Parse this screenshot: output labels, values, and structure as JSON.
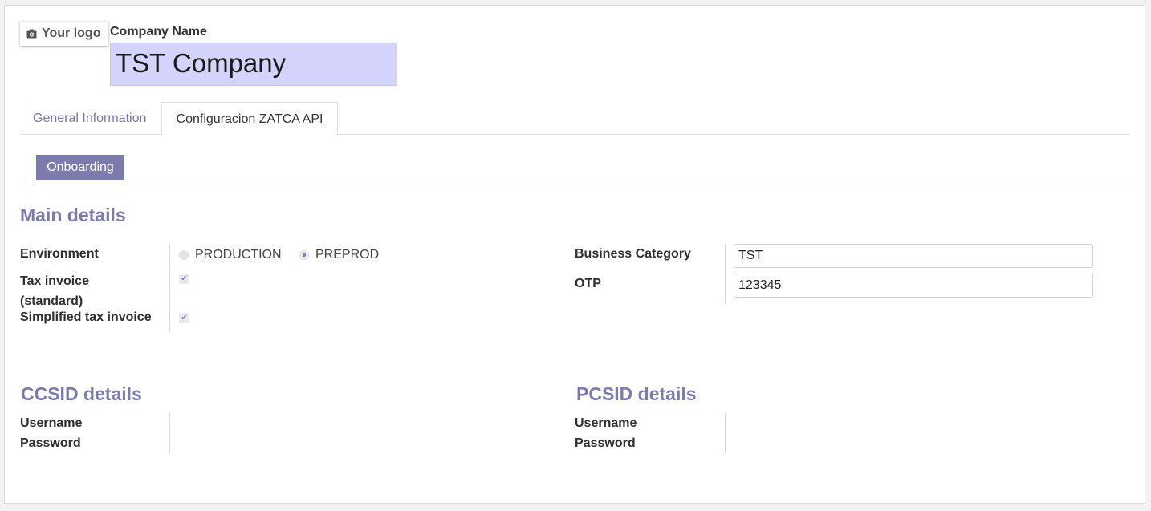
{
  "header": {
    "logo_label": "Your logo",
    "company_name_label": "Company Name",
    "company_name_value": "TST Company"
  },
  "tabs": [
    {
      "label": "General Information",
      "active": false
    },
    {
      "label": "Configuracion ZATCA API",
      "active": true
    }
  ],
  "buttons": {
    "onboarding": "Onboarding"
  },
  "main_details": {
    "title": "Main details",
    "environment_label": "Environment",
    "environment_options": [
      "PRODUCTION",
      "PREPROD"
    ],
    "environment_selected": "PREPROD",
    "tax_invoice_label_line1": "Tax invoice",
    "tax_invoice_label_line2": "(standard)",
    "tax_invoice_checked": true,
    "simplified_label": "Simplified tax invoice",
    "simplified_checked": true,
    "business_category_label": "Business Category",
    "business_category_value": "TST",
    "otp_label": "OTP",
    "otp_value": "123345"
  },
  "ccsid": {
    "title": "CCSID details",
    "username_label": "Username",
    "password_label": "Password"
  },
  "pcsid": {
    "title": "PCSID details",
    "username_label": "Username",
    "password_label": "Password"
  },
  "colors": {
    "accent": "#7c7bad",
    "highlight_input": "#d3d3fb"
  },
  "icons": {
    "logo": "camera-icon",
    "check": "check-icon"
  }
}
